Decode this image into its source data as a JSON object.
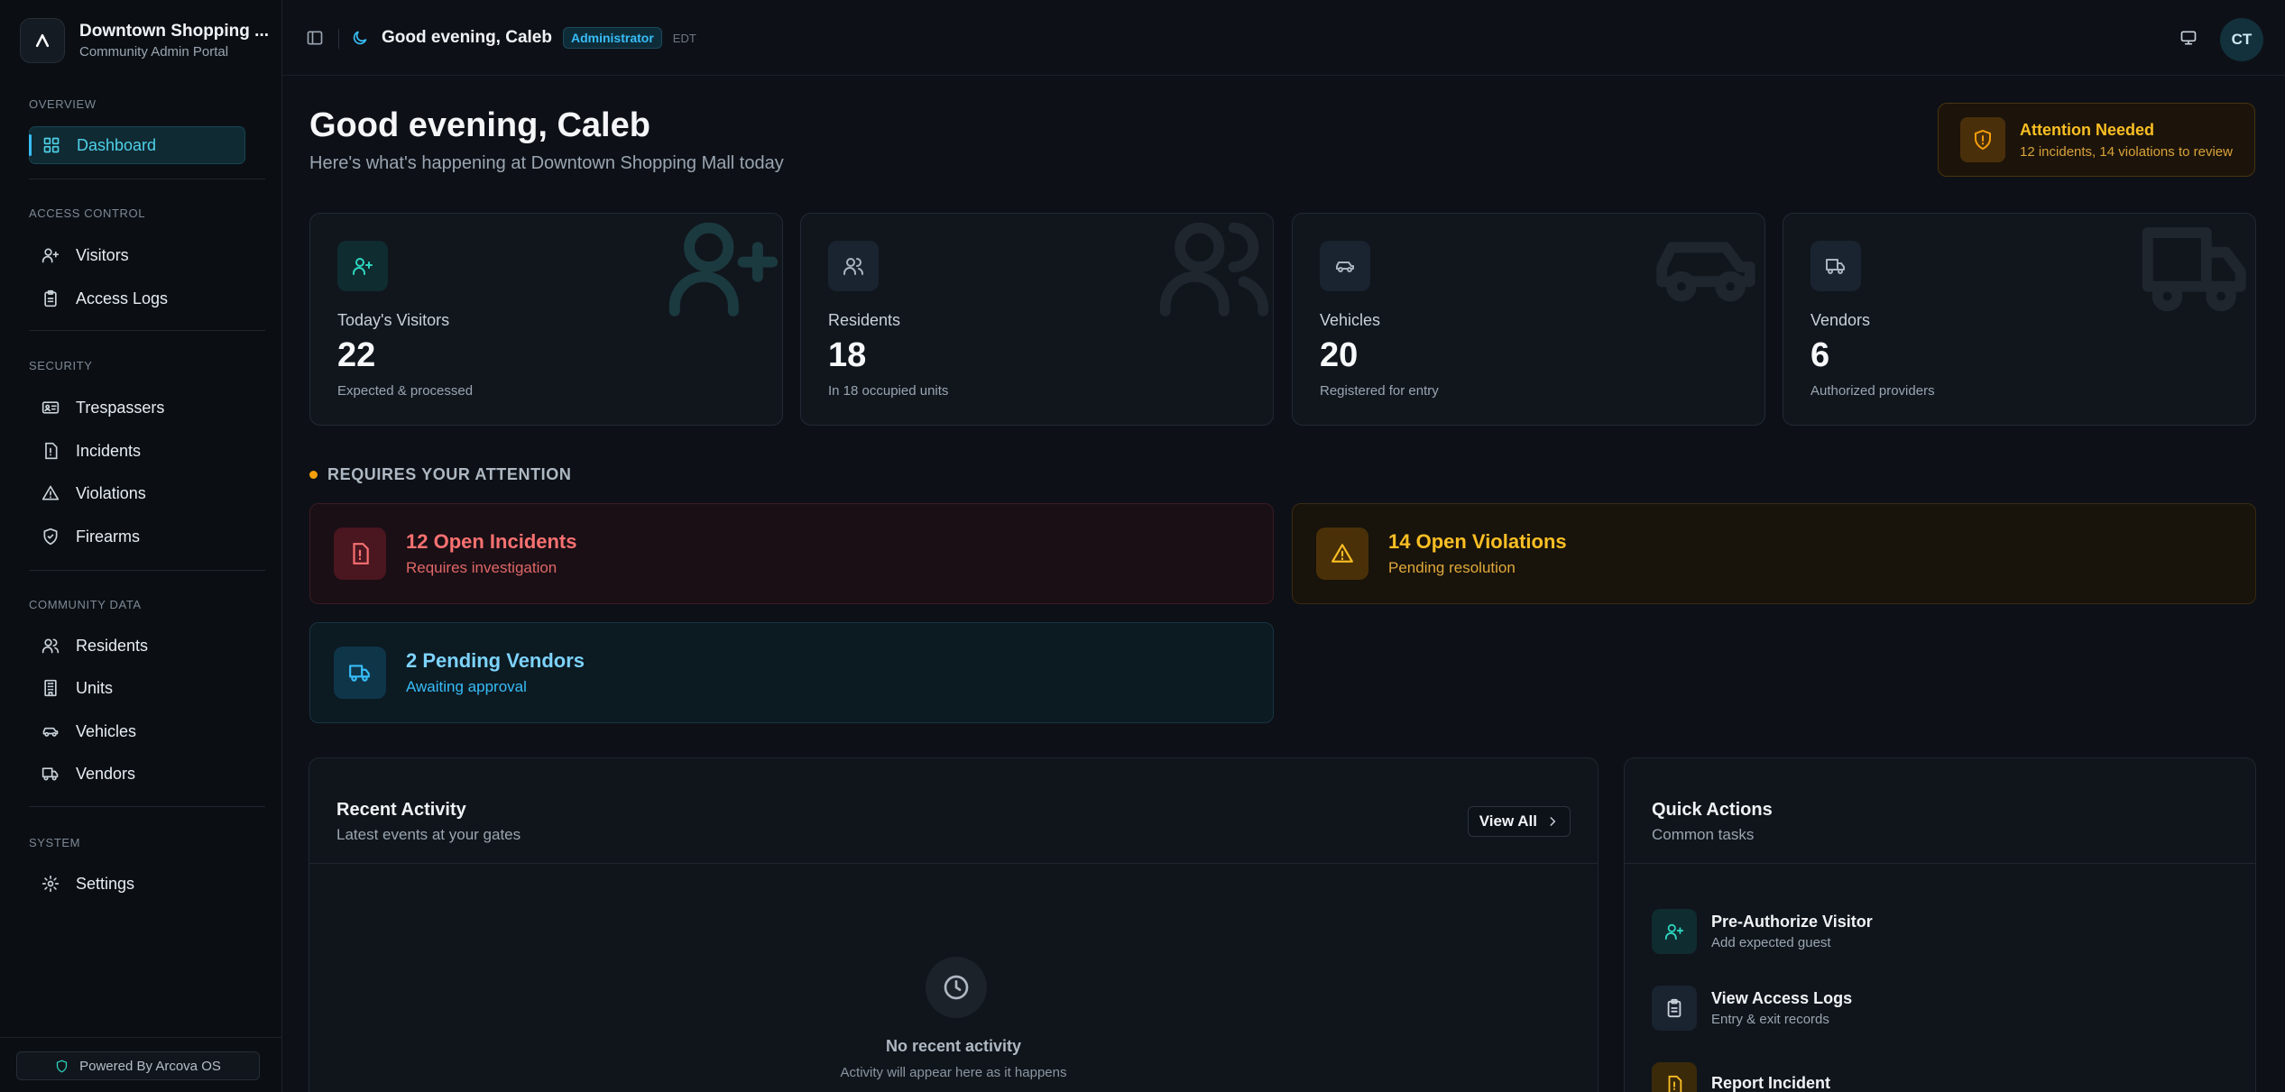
{
  "brand": {
    "name": "Downtown Shopping ...",
    "subtitle": "Community Admin Portal",
    "logo_letter": "A"
  },
  "sidebar": {
    "sections": {
      "overview": "OVERVIEW",
      "access_control": "ACCESS CONTROL",
      "security": "SECURITY",
      "community_data": "COMMUNITY DATA",
      "system": "SYSTEM"
    },
    "items": {
      "dashboard": "Dashboard",
      "visitors": "Visitors",
      "access_logs": "Access Logs",
      "trespassers": "Trespassers",
      "incidents": "Incidents",
      "violations": "Violations",
      "firearms": "Firearms",
      "residents": "Residents",
      "units": "Units",
      "vehicles": "Vehicles",
      "vendors": "Vendors",
      "settings": "Settings"
    },
    "powered_by": "Powered By Arcova OS"
  },
  "header": {
    "greeting": "Good evening, Caleb",
    "role_badge": "Administrator",
    "timezone": "EDT",
    "avatar_initials": "CT"
  },
  "page": {
    "title": "Good evening, Caleb",
    "subtitle": "Here's what's happening at Downtown Shopping Mall today"
  },
  "attention": {
    "title": "Attention Needed",
    "detail": "12 incidents, 14 violations to review"
  },
  "stats": [
    {
      "label": "Today's Visitors",
      "value": "22",
      "note": "Expected & processed"
    },
    {
      "label": "Residents",
      "value": "18",
      "note": "In 18 occupied units"
    },
    {
      "label": "Vehicles",
      "value": "20",
      "note": "Registered for entry"
    },
    {
      "label": "Vendors",
      "value": "6",
      "note": "Authorized providers"
    }
  ],
  "requires_attention": {
    "title": "REQUIRES YOUR ATTENTION",
    "incidents": {
      "title": "12 Open Incidents",
      "subtitle": "Requires investigation"
    },
    "violations": {
      "title": "14 Open Violations",
      "subtitle": "Pending resolution"
    },
    "vendors": {
      "title": "2 Pending Vendors",
      "subtitle": "Awaiting approval"
    }
  },
  "recent_activity": {
    "title": "Recent Activity",
    "subtitle": "Latest events at your gates",
    "view_all": "View All",
    "empty_title": "No recent activity",
    "empty_subtitle": "Activity will appear here as it happens"
  },
  "quick_actions": {
    "title": "Quick Actions",
    "subtitle": "Common tasks",
    "items": [
      {
        "title": "Pre-Authorize Visitor",
        "subtitle": "Add expected guest"
      },
      {
        "title": "View Access Logs",
        "subtitle": "Entry & exit records"
      },
      {
        "title": "Report Incident",
        "subtitle": ""
      }
    ]
  },
  "colors": {
    "accent": "#38bdf8",
    "teal": "#2dd4bf",
    "danger": "#f87171",
    "warning": "#fbbf24",
    "background": "#0d1117"
  }
}
